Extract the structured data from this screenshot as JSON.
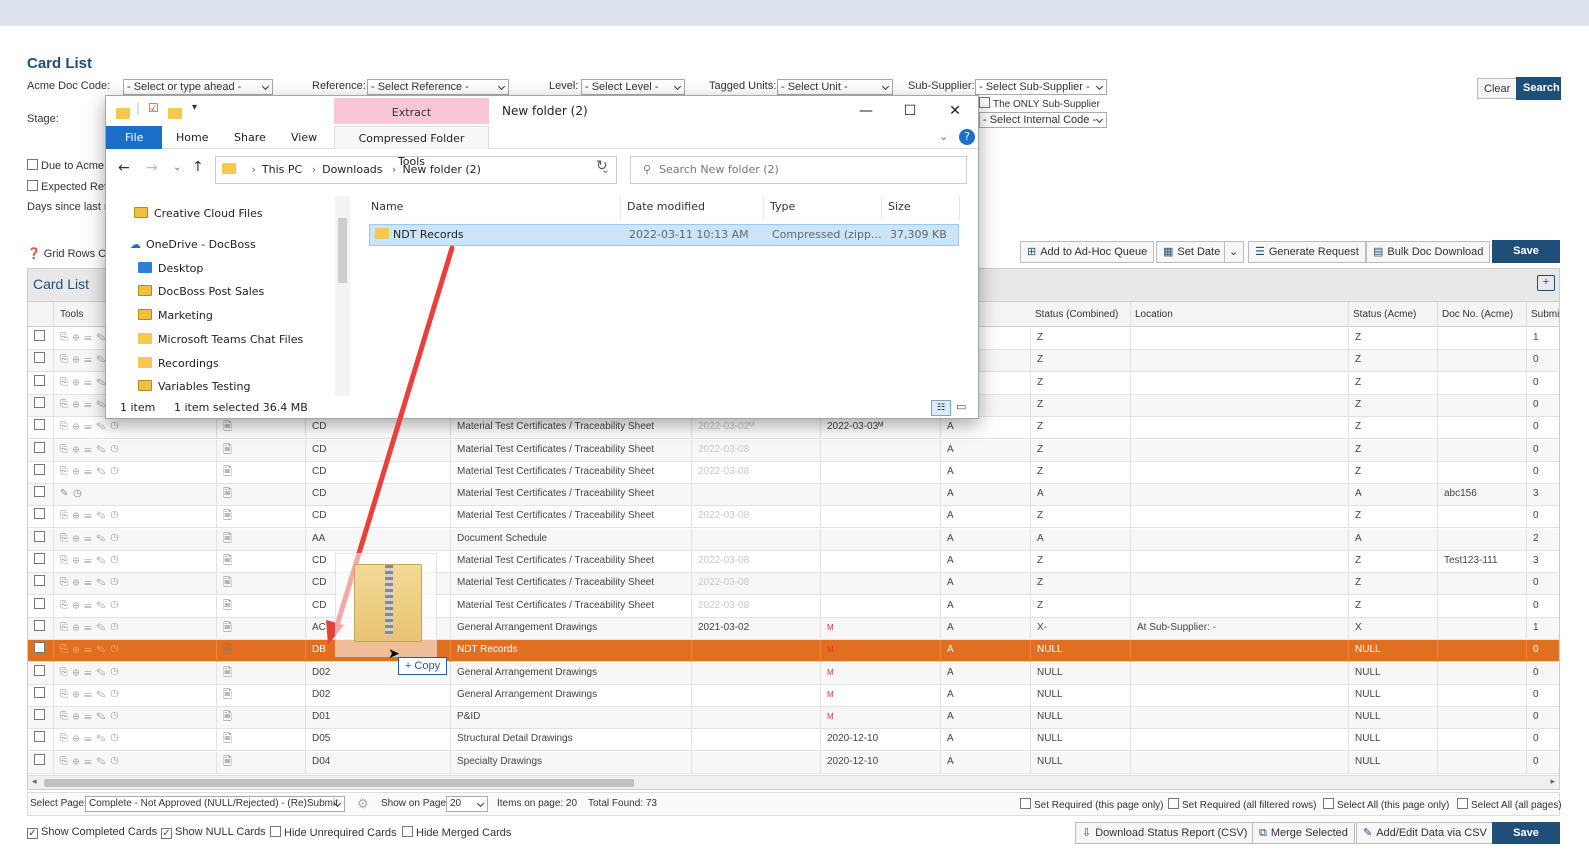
{
  "page": {
    "title": "Card List"
  },
  "filters": {
    "acme_doc_code_label": "Acme Doc Code:",
    "acme_doc_code_value": "- Select or type ahead -",
    "reference_label": "Reference:",
    "reference_value": "- Select Reference -",
    "level_label": "Level:",
    "level_value": "- Select Level -",
    "tagged_units_label": "Tagged Units:",
    "tagged_units_value": "- Select Unit -",
    "sub_supplier_label": "Sub-Supplier:",
    "sub_supplier_value": "- Select Sub-Supplier -",
    "only_sub_supplier": "The ONLY Sub-Supplier",
    "internal_code_value": "- Select Internal Code -",
    "stage_label": "Stage:",
    "due_to_acme": "Due to Acme:",
    "expected_ret": "Expected Ret",
    "days_since": "Days since last re",
    "clear": "Clear",
    "search": "Search"
  },
  "toolbar": {
    "grid_rows": "Grid Rows Co",
    "add_adhoc": "Add to Ad-Hoc Queue",
    "set_date": "Set Date",
    "generate_request": "Generate Request",
    "bulk_download": "Bulk Doc Download",
    "save": "Save"
  },
  "grid": {
    "title": "Card List",
    "headers": {
      "tools": "Tools",
      "status_combined": "Status (Combined)",
      "location": "Location",
      "status_acme": "Status (Acme)",
      "doc_no_acme": "Doc No. (Acme)",
      "submit": "Submi"
    },
    "rows": [
      {
        "code": "",
        "title": "",
        "date1": "",
        "date2": "",
        "lvl": "",
        "sc": "Z",
        "loc": "",
        "sa": "Z",
        "docno": "",
        "sub": "1"
      },
      {
        "code": "",
        "title": "",
        "date1": "",
        "date2": "",
        "lvl": "",
        "sc": "Z",
        "loc": "",
        "sa": "Z",
        "docno": "",
        "sub": "0"
      },
      {
        "code": "",
        "title": "",
        "date1": "",
        "date2": "",
        "lvl": "",
        "sc": "Z",
        "loc": "",
        "sa": "Z",
        "docno": "",
        "sub": "0"
      },
      {
        "code": "",
        "title": "",
        "date1": "",
        "date2": "",
        "lvl": "",
        "sc": "Z",
        "loc": "",
        "sa": "Z",
        "docno": "",
        "sub": "0"
      },
      {
        "code": "CD",
        "title": "Material Test Certificates / Traceability Sheet",
        "date1": "2022-03-02ᴹ",
        "date2": "2022-03-03ᴹ",
        "lvl": "A",
        "sc": "Z",
        "loc": "",
        "sa": "Z",
        "docno": "",
        "sub": "0"
      },
      {
        "code": "CD",
        "title": "Material Test Certificates / Traceability Sheet",
        "date1": "2022-03-08",
        "date2": "",
        "lvl": "A",
        "sc": "Z",
        "loc": "",
        "sa": "Z",
        "docno": "",
        "sub": "0"
      },
      {
        "code": "CD",
        "title": "Material Test Certificates / Traceability Sheet",
        "date1": "2022-03-08",
        "date2": "",
        "lvl": "A",
        "sc": "Z",
        "loc": "",
        "sa": "Z",
        "docno": "",
        "sub": "0"
      },
      {
        "code": "CD",
        "title": "Material Test Certificates / Traceability Sheet",
        "date1": "",
        "date2": "",
        "lvl": "A",
        "sc": "A",
        "loc": "",
        "sa": "A",
        "docno": "abc156",
        "sub": "3"
      },
      {
        "code": "CD",
        "title": "Material Test Certificates / Traceability Sheet",
        "date1": "2022-03-08",
        "date2": "",
        "lvl": "A",
        "sc": "Z",
        "loc": "",
        "sa": "Z",
        "docno": "",
        "sub": "0"
      },
      {
        "code": "AA",
        "title": "Document Schedule",
        "date1": "",
        "date2": "",
        "lvl": "A",
        "sc": "A",
        "loc": "",
        "sa": "A",
        "docno": "",
        "sub": "2"
      },
      {
        "code": "CD",
        "title": "Material Test Certificates / Traceability Sheet",
        "date1": "2022-03-08",
        "date2": "",
        "lvl": "A",
        "sc": "Z",
        "loc": "",
        "sa": "Z",
        "docno": "Test123-111",
        "sub": "3"
      },
      {
        "code": "CD",
        "title": "Material Test Certificates / Traceability Sheet",
        "date1": "2022-03-08",
        "date2": "",
        "lvl": "A",
        "sc": "Z",
        "loc": "",
        "sa": "Z",
        "docno": "",
        "sub": "0"
      },
      {
        "code": "CD",
        "title": "Material Test Certificates / Traceability Sheet",
        "date1": "2022-03-08",
        "date2": "",
        "lvl": "A",
        "sc": "Z",
        "loc": "",
        "sa": "Z",
        "docno": "",
        "sub": "0"
      },
      {
        "code": "AC",
        "title": "General Arrangement Drawings",
        "date1": "2021-03-02",
        "date2": "M",
        "lvl": "A",
        "sc": "X-",
        "loc": "At Sub-Supplier: -",
        "sa": "X",
        "docno": "",
        "sub": "1"
      },
      {
        "code": "DB",
        "title": "NDT Records",
        "date1": "",
        "date2": "M",
        "lvl": "A",
        "sc": "NULL",
        "loc": "",
        "sa": "NULL",
        "docno": "",
        "sub": "0"
      },
      {
        "code": "D02",
        "title": "General Arrangement Drawings",
        "date1": "",
        "date2": "M",
        "lvl": "A",
        "sc": "NULL",
        "loc": "",
        "sa": "NULL",
        "docno": "",
        "sub": "0"
      },
      {
        "code": "D02",
        "title": "General Arrangement Drawings",
        "date1": "",
        "date2": "M",
        "lvl": "A",
        "sc": "NULL",
        "loc": "",
        "sa": "NULL",
        "docno": "",
        "sub": "0"
      },
      {
        "code": "D01",
        "title": "P&ID",
        "date1": "",
        "date2": "M",
        "lvl": "A",
        "sc": "NULL",
        "loc": "",
        "sa": "NULL",
        "docno": "",
        "sub": "0"
      },
      {
        "code": "D05",
        "title": "Structural Detail Drawings",
        "date1": "",
        "date2": "2020-12-10",
        "lvl": "A",
        "sc": "NULL",
        "loc": "",
        "sa": "NULL",
        "docno": "",
        "sub": "0"
      },
      {
        "code": "D04",
        "title": "Specialty Drawings",
        "date1": "",
        "date2": "2020-12-10",
        "lvl": "A",
        "sc": "NULL",
        "loc": "",
        "sa": "NULL",
        "docno": "",
        "sub": "0"
      }
    ]
  },
  "footer": {
    "select_page_label": "Select Page:",
    "select_page_value": "Complete - Not Approved (NULL/Rejected) - (Re)Submit",
    "show_on_page_label": "Show on Page:",
    "show_on_page_value": "20",
    "items_on_page": "Items on page: 20",
    "total_found": "Total Found: 73",
    "set_required_page": "Set Required (this page only)",
    "set_required_all": "Set Required (all filtered rows)",
    "select_all_page": "Select All (this page only)",
    "select_all_all": "Select All (all pages)"
  },
  "bottom": {
    "show_completed": "Show Completed Cards",
    "show_null": "Show NULL Cards",
    "hide_unrequired": "Hide Unrequired Cards",
    "hide_merged": "Hide Merged Cards",
    "download_status": "Download Status Report (CSV)",
    "merge_selected": "Merge Selected",
    "add_edit_csv": "Add/Edit Data via CSV",
    "save": "Save"
  },
  "explorer": {
    "extract": "Extract",
    "window_title": "New folder (2)",
    "tabs": [
      "File",
      "Home",
      "Share",
      "View",
      "Compressed Folder Tools"
    ],
    "path": [
      "This PC",
      "Downloads",
      "New folder (2)"
    ],
    "search_placeholder": "Search New folder (2)",
    "nav_items": [
      "Creative Cloud Files",
      "OneDrive - DocBoss",
      "Desktop",
      "DocBoss Post Sales",
      "Marketing",
      "Microsoft Teams Chat Files",
      "Recordings",
      "Variables Testing"
    ],
    "columns": [
      "Name",
      "Date modified",
      "Type",
      "Size"
    ],
    "file": {
      "name": "NDT Records",
      "date": "2022-03-11 10:13 AM",
      "type": "Compressed (zipp...",
      "size": "37,309 KB"
    },
    "status_count": "1 item",
    "status_selected": "1 item selected  36.4 MB"
  },
  "drag": {
    "copy_label": "+ Copy"
  },
  "colors": {
    "accent": "#1f4e79",
    "highlight_row": "#e07020",
    "arrow": "#e8403a"
  }
}
